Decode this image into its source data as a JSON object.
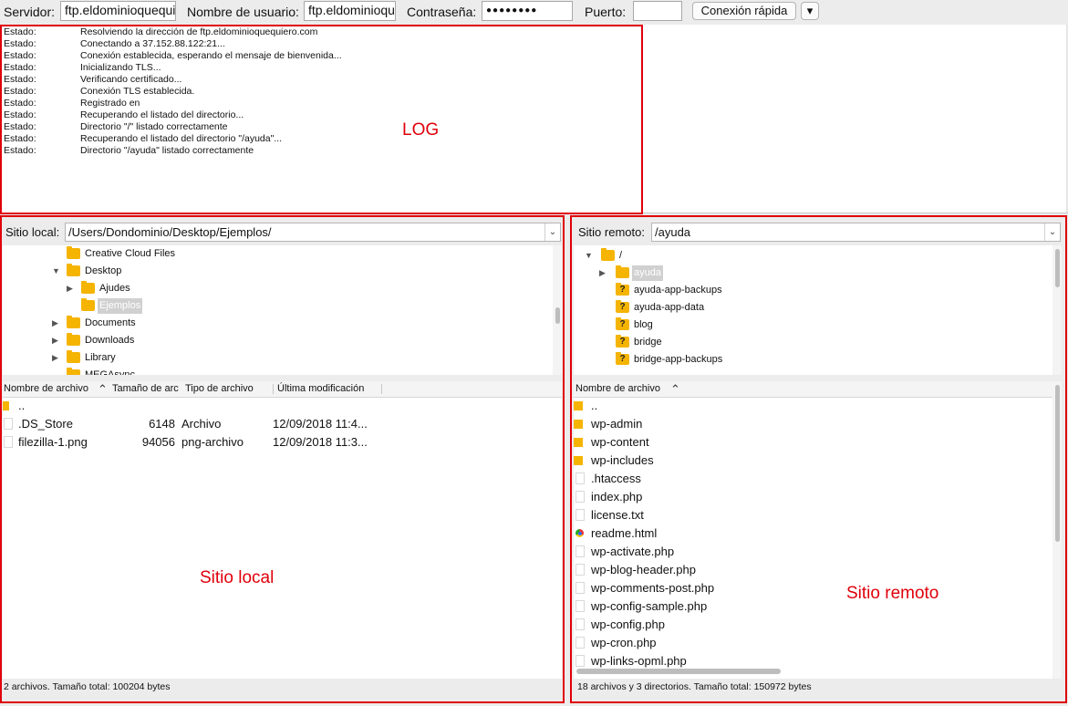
{
  "quickconnect": {
    "host_label": "Servidor:",
    "host_value": "ftp.eldominioquequi",
    "user_label": "Nombre de usuario:",
    "user_value": "ftp.eldominioqueq",
    "pass_label": "Contraseña:",
    "pass_value": "●●●●●●●●",
    "port_label": "Puerto:",
    "port_value": "",
    "connect_label": "Conexión rápida",
    "dropdown_glyph": "▾"
  },
  "log": {
    "label": "Estado:",
    "messages": [
      "Resolviendo la dirección de ftp.eldominioquequiero.com",
      "Conectando a 37.152.88.122:21...",
      "Conexión establecida, esperando el mensaje de bienvenida...",
      "Inicializando TLS...",
      "Verificando certificado...",
      "Conexión TLS establecida.",
      "Registrado en",
      "Recuperando el listado del directorio...",
      "Directorio \"/\" listado correctamente",
      "Recuperando el listado del directorio \"/ayuda\"...",
      "Directorio \"/ayuda\" listado correctamente"
    ]
  },
  "local": {
    "path_label": "Sitio local:",
    "path_value": "/Users/Dondominio/Desktop/Ejemplos/",
    "tree": [
      {
        "name": "Creative Cloud Files",
        "expander": ""
      },
      {
        "name": "Desktop",
        "expander": "▼"
      },
      {
        "name": "Ajudes",
        "expander": "▶"
      },
      {
        "name": "Ejemplos",
        "expander": ""
      },
      {
        "name": "Documents",
        "expander": "▶"
      },
      {
        "name": "Downloads",
        "expander": "▶"
      },
      {
        "name": "Library",
        "expander": "▶"
      },
      {
        "name": "MEGAsync",
        "expander": ""
      }
    ],
    "columns": [
      "Nombre de archivo",
      "Tamaño de arc",
      "Tipo de archivo",
      "Última modificación"
    ],
    "sort_glyph": "⌃",
    "files": [
      {
        "name": "..",
        "size": "",
        "type": "",
        "modified": ""
      },
      {
        "name": ".DS_Store",
        "size": "6148",
        "type": "Archivo",
        "modified": "12/09/2018 11:4..."
      },
      {
        "name": "filezilla-1.png",
        "size": "94056",
        "type": "png-archivo",
        "modified": "12/09/2018 11:3..."
      }
    ],
    "status": "2 archivos. Tamaño total: 100204 bytes"
  },
  "remote": {
    "path_label": "Sitio remoto:",
    "path_value": "/ayuda",
    "tree": [
      {
        "name": "/",
        "expander": "▼"
      },
      {
        "name": "ayuda",
        "expander": "▶"
      },
      {
        "name": "ayuda-app-backups",
        "expander": ""
      },
      {
        "name": "ayuda-app-data",
        "expander": ""
      },
      {
        "name": "blog",
        "expander": ""
      },
      {
        "name": "bridge",
        "expander": ""
      },
      {
        "name": "bridge-app-backups",
        "expander": ""
      }
    ],
    "unknown_glyph": "?",
    "columns": [
      "Nombre de archivo"
    ],
    "sort_glyph": "⌃",
    "files": [
      {
        "name": ".."
      },
      {
        "name": "wp-admin"
      },
      {
        "name": "wp-content"
      },
      {
        "name": "wp-includes"
      },
      {
        "name": ".htaccess"
      },
      {
        "name": "index.php"
      },
      {
        "name": "license.txt"
      },
      {
        "name": "readme.html"
      },
      {
        "name": "wp-activate.php"
      },
      {
        "name": "wp-blog-header.php"
      },
      {
        "name": "wp-comments-post.php"
      },
      {
        "name": "wp-config-sample.php"
      },
      {
        "name": "wp-config.php"
      },
      {
        "name": "wp-cron.php"
      },
      {
        "name": "wp-links-opml.php"
      }
    ],
    "status": "18 archivos y 3 directorios. Tamaño total: 150972 bytes"
  },
  "annotations": {
    "log": "LOG",
    "local": "Sitio local",
    "remote": "Sitio remoto"
  }
}
